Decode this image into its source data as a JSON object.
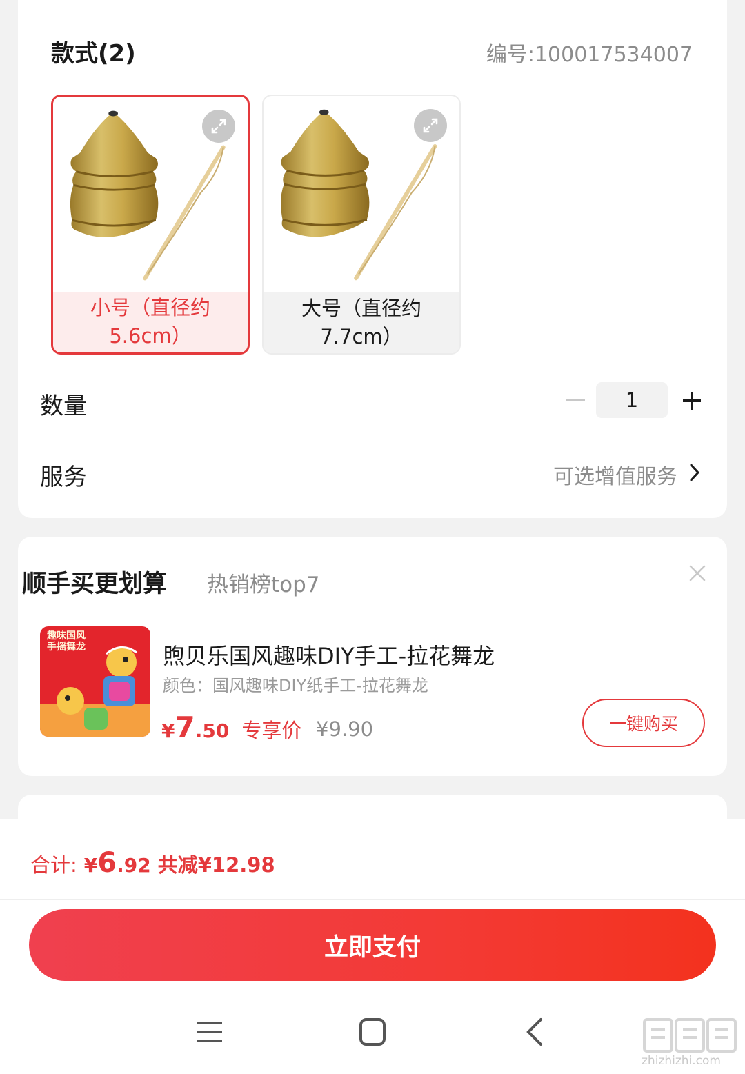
{
  "style_section": {
    "title": "款式(2)",
    "sku_number": "编号:100017534007",
    "options": [
      {
        "label": "小号（直径约5.6cm）",
        "selected": true
      },
      {
        "label": "大号（直径约7.7cm）",
        "selected": false
      }
    ]
  },
  "quantity": {
    "label": "数量",
    "value": "1"
  },
  "service": {
    "label": "服务",
    "value": "可选增值服务"
  },
  "addon": {
    "title": "顺手买更划算",
    "subtitle": "热销榜top7",
    "product": {
      "name": "煦贝乐国风趣味DIY手工-拉花舞龙",
      "spec": "颜色：国风趣味DIY纸手工-拉花舞龙",
      "thumb_text": "趣味国风 手摇舞龙",
      "price_currency": "¥",
      "price_int": "7",
      "price_dec": ".50",
      "price_tag": "专享价",
      "original_price": "¥9.90",
      "buy_label": "一键购买"
    }
  },
  "summary": {
    "total_label": "合计:",
    "currency": "¥",
    "total_int": "6",
    "total_dec": ".92",
    "discount": "共减¥12.98"
  },
  "pay_button": "立即支付",
  "watermark": "zhizhizhi.com",
  "colors": {
    "accent": "#e4393c",
    "pay_start": "#f0404f",
    "pay_end": "#f3321e"
  }
}
